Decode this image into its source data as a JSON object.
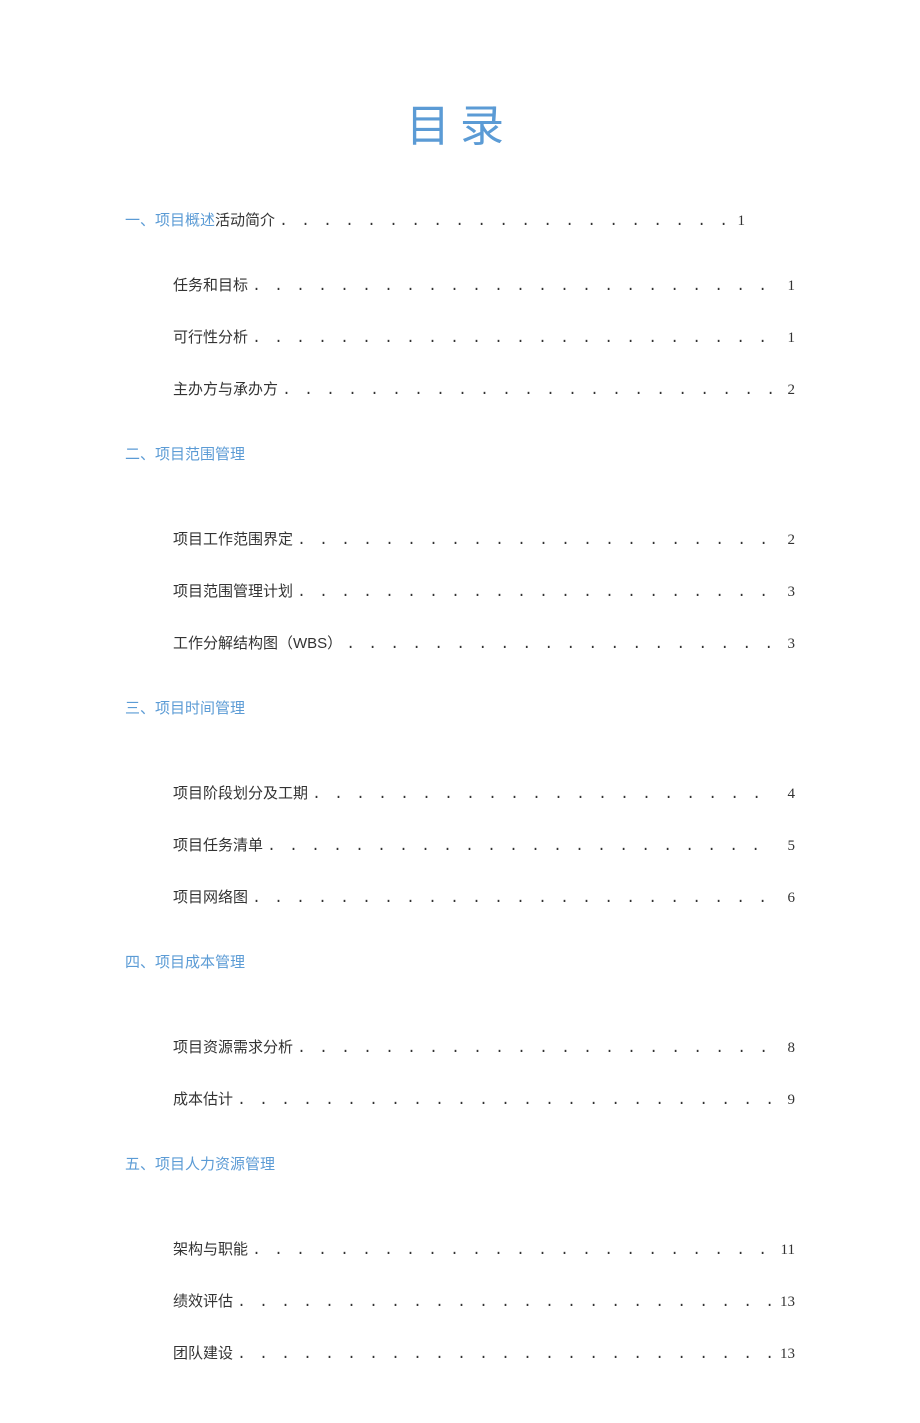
{
  "title": "目录",
  "section1": {
    "number": "一、",
    "link": "项目概述",
    "after": "活动简介",
    "page": "1",
    "items": [
      {
        "label": "任务和目标",
        "page": "1"
      },
      {
        "label": "可行性分析",
        "page": "1"
      },
      {
        "label": "主办方与承办方",
        "page": "2"
      }
    ]
  },
  "section2": {
    "heading": "二、项目范围管理",
    "items": [
      {
        "label": "项目工作范围界定",
        "page": "2"
      },
      {
        "label": "项目范围管理计划",
        "page": "3"
      },
      {
        "label": "工作分解结构图（WBS）",
        "page": "3"
      }
    ]
  },
  "section3": {
    "heading": "三、项目时间管理",
    "items": [
      {
        "label": "项目阶段划分及工期",
        "page": "4"
      },
      {
        "label": "项目任务清单",
        "page": "5"
      },
      {
        "label": "项目网络图",
        "page": "6"
      }
    ]
  },
  "section4": {
    "heading": "四、项目成本管理",
    "items": [
      {
        "label": "项目资源需求分析",
        "page": "8"
      },
      {
        "label": "成本估计",
        "page": "9"
      }
    ]
  },
  "section5": {
    "heading": "五、项目人力资源管理",
    "items": [
      {
        "label": "架构与职能",
        "page": "11"
      },
      {
        "label": "绩效评估",
        "page": "13"
      },
      {
        "label": "团队建设",
        "page": "13"
      }
    ]
  }
}
